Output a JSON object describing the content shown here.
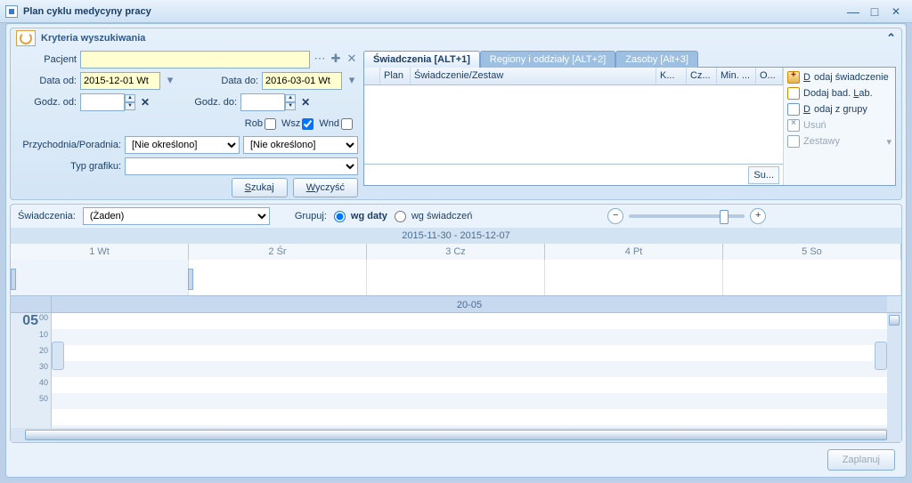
{
  "window": {
    "title": "Plan cyklu medycyny pracy"
  },
  "criteria": {
    "header": "Kryteria wyszukiwania",
    "patient_label": "Pacjent",
    "patient_value": "",
    "date_from_label": "Data od:",
    "date_from": "2015-12-01 Wt",
    "date_to_label": "Data do:",
    "date_to": "2016-03-01 Wt",
    "time_from_label": "Godz. od:",
    "time_from": "",
    "time_to_label": "Godz. do:",
    "time_to": "",
    "days": {
      "rob": "Rob",
      "wsz": "Wsz",
      "wnd": "Wnd"
    },
    "clinic_label": "Przychodnia/Poradnia:",
    "clinic_value": "[Nie określono]",
    "poradnia_value": "[Nie określono]",
    "graph_type_label": "Typ grafiku:",
    "graph_type_value": "",
    "search_btn": "Szukaj",
    "clear_btn": "Wyczyść"
  },
  "tabs": {
    "t1": "Świadczenia [ALT+1]",
    "t2": "Regiony i oddziały [ALT+2]",
    "t3": "Zasoby [Alt+3]"
  },
  "grid": {
    "cols": {
      "plan": "Plan",
      "swz": "Świadczenie/Zestaw",
      "k": "K...",
      "cz": "Cz...",
      "min": "Min. ...",
      "o": "O..."
    },
    "sum_btn": "Su..."
  },
  "actions": {
    "add_sw": "Dodaj świadczenie",
    "add_lab": "Dodaj bad. Lab.",
    "add_grp": "Dodaj z grupy",
    "del": "Usuń",
    "sets": "Zestawy"
  },
  "schedule": {
    "sw_label": "Świadczenia:",
    "sw_value": "(Żaden)",
    "group_label": "Grupuj:",
    "group_opt1": "wg daty",
    "group_opt2": "wg świadczeń",
    "week_range": "2015-11-30 - 2015-12-07",
    "days": {
      "d1": "1 Wt",
      "d2": "2 Śr",
      "d3": "3 Cz",
      "d4": "4 Pt",
      "d5": "5 So"
    },
    "allday": "20-05",
    "hours": {
      "h": "05",
      "m0": "00",
      "rows": [
        "10",
        "20",
        "30",
        "40",
        "50"
      ]
    }
  },
  "footer": {
    "plan_btn": "Zaplanuj"
  }
}
